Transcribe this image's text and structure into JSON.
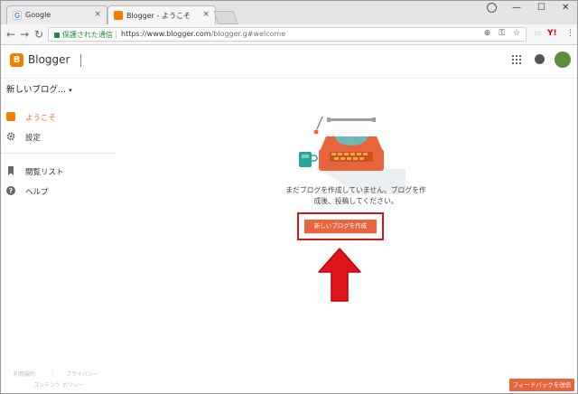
{
  "browser": {
    "tabs": [
      {
        "title": "Google",
        "active": false
      },
      {
        "title": "Blogger - ようこそ",
        "active": true
      }
    ],
    "omnibox": {
      "secure_label": "保護された通信",
      "url_host": "https://www.blogger.com",
      "url_path": "/blogger.g#welcome"
    },
    "tab_close_glyph": "×",
    "nav": {
      "back": "←",
      "forward": "→",
      "reload": "↻"
    },
    "omnibox_icons": {
      "zoom": "⊕",
      "key": "⚿",
      "star": "☆"
    },
    "window_controls": {
      "minimize": "—",
      "maximize": "☐",
      "close": "✕"
    },
    "extensions": {
      "yahoo": "Y!",
      "menu": "⋮"
    }
  },
  "app": {
    "brand": "Blogger",
    "logo_letter": "B",
    "accent_color": "#f57d00"
  },
  "sidebar": {
    "blog_selector": "新しいブログ...",
    "caret": "▾",
    "items": [
      {
        "label": "ようこそ",
        "icon": "blogger-icon",
        "active": true
      },
      {
        "label": "設定",
        "icon": "gear-icon",
        "active": false
      },
      {
        "label": "閲覧リスト",
        "icon": "bookmark-icon",
        "active": false
      },
      {
        "label": "ヘルプ",
        "icon": "help-icon",
        "active": false
      }
    ],
    "footer": {
      "terms": "利用規約",
      "privacy": "プライバシー",
      "content_policy": "コンテンツ ポリシー"
    }
  },
  "main": {
    "empty_message_line1": "まだブログを作成していません。ブログを作",
    "empty_message_line2": "成後、投稿してください。",
    "create_button": "新しいブログを作成",
    "highlight_color": "#d6151a"
  },
  "feedback_button": "フィードバックを送信"
}
